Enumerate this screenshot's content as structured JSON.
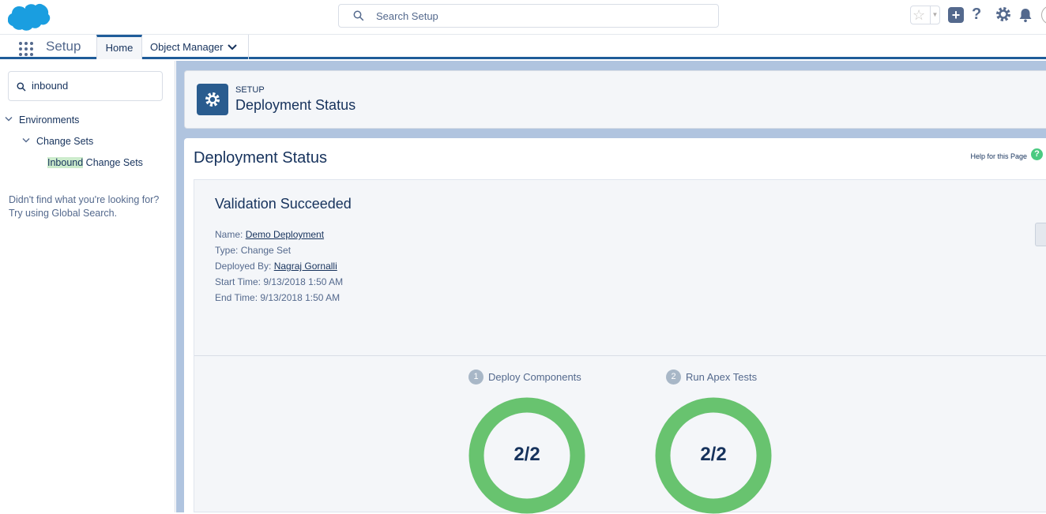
{
  "header": {
    "search_placeholder": "Search Setup"
  },
  "nav": {
    "app_name": "Setup",
    "tabs": [
      {
        "label": "Home"
      },
      {
        "label": "Object Manager"
      }
    ]
  },
  "sidebar": {
    "quick_find_value": "inbound",
    "tree": {
      "environments": "Environments",
      "change_sets": "Change Sets",
      "inbound_highlight": "Inbound",
      "inbound_rest": " Change Sets"
    },
    "not_found_line1": "Didn't find what you're looking for?",
    "not_found_line2": "Try using Global Search."
  },
  "page_header": {
    "eyebrow": "SETUP",
    "title": "Deployment Status"
  },
  "content": {
    "title": "Deployment Status",
    "help_link": "Help for this Page",
    "status": {
      "heading": "Validation Succeeded",
      "name_label": "Name: ",
      "name_value": "Demo Deployment",
      "type_label": "Type: ",
      "type_value": "Change Set",
      "deployed_by_label": "Deployed By: ",
      "deployed_by_value": "Nagraj Gornalli",
      "start_label": "Start Time: ",
      "start_value": "9/13/2018 1:50 AM",
      "end_label": "End Time: ",
      "end_value": "9/13/2018 1:50 AM"
    },
    "steps": [
      {
        "number": "1",
        "label": "Deploy Components",
        "progress": "2/2",
        "fraction": 1.0
      },
      {
        "number": "2",
        "label": "Run Apex Tests",
        "progress": "2/2",
        "fraction": 1.0
      }
    ],
    "colors": {
      "success_ring": "#68c36f",
      "brand": "#1f5c99"
    }
  }
}
